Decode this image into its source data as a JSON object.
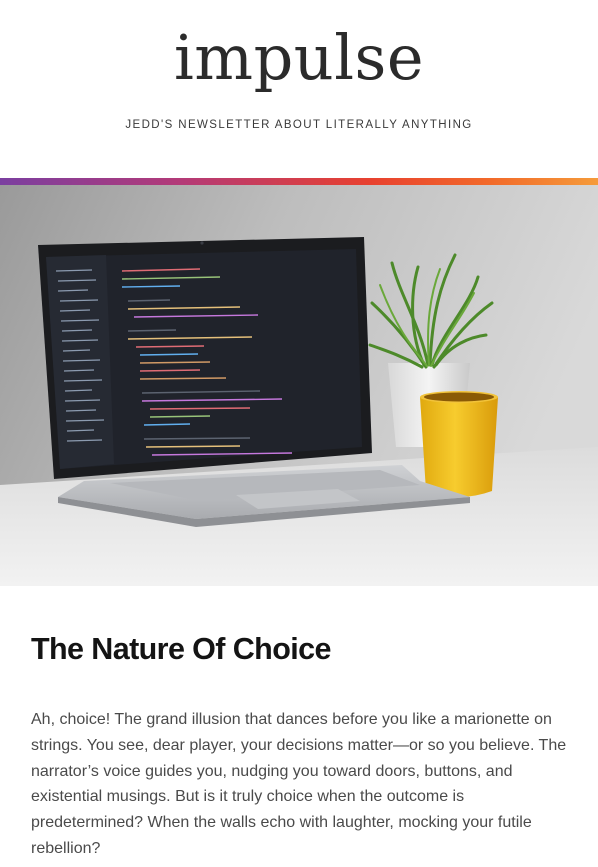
{
  "newsletter": {
    "name": "impulse",
    "tagline": "JEDD'S NEWSLETTER ABOUT LITERALLY ANYTHING"
  },
  "colors": {
    "accent_bar_start": "#7b3fa0",
    "accent_bar_mid": "#e8412f",
    "accent_bar_end": "#f59b3a",
    "title_text": "#141414",
    "body_text": "#4a4a4a"
  },
  "hero_image": {
    "subject": "laptop-with-code-editor-plant-and-yellow-mug"
  },
  "article": {
    "title": "The Nature Of Choice",
    "body": "Ah, choice! The grand illusion that dances before you like a marionette on strings. You see, dear player, your decisions matter—or so you believe. The narrator’s voice guides you, nudging you toward doors, buttons, and existential musings. But is it truly choice when the outcome is predetermined? When the walls echo with laughter, mocking your futile rebellion?"
  }
}
